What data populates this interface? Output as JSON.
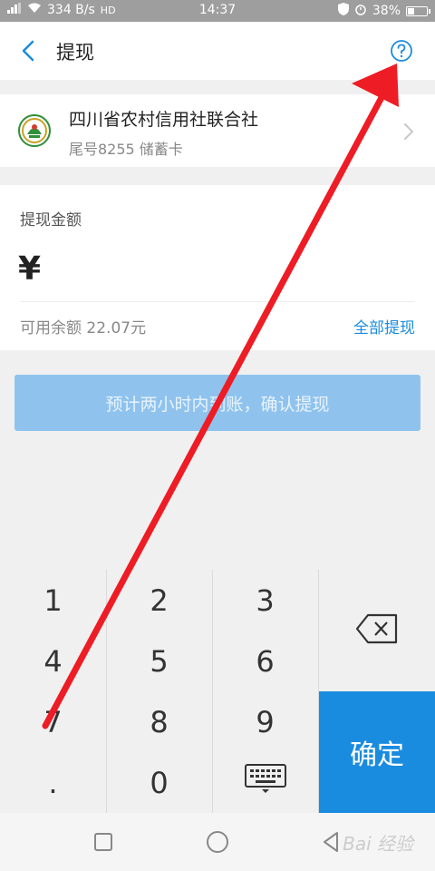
{
  "status_bar": {
    "signal": "⁵ᴳ",
    "network_speed": "334 B/s",
    "time": "14:37",
    "battery": "38%",
    "battery_level": 0.38
  },
  "header": {
    "title": "提现"
  },
  "bank": {
    "name": "四川省农村信用社联合社",
    "card_info": "尾号8255 储蓄卡"
  },
  "amount": {
    "label": "提现金额",
    "currency": "¥",
    "available": "可用余额 22.07元",
    "withdraw_all": "全部提现"
  },
  "confirm_button": "预计两小时内到账，确认提现",
  "keypad": {
    "keys": [
      "1",
      "2",
      "3",
      "4",
      "5",
      "6",
      "7",
      "8",
      "9",
      ".",
      "0"
    ],
    "ok": "确定"
  },
  "colors": {
    "accent": "#1a8ce0",
    "disabled_button": "#8fc3ee",
    "arrow": "#ee1c25"
  },
  "watermark": "Bai 经验"
}
